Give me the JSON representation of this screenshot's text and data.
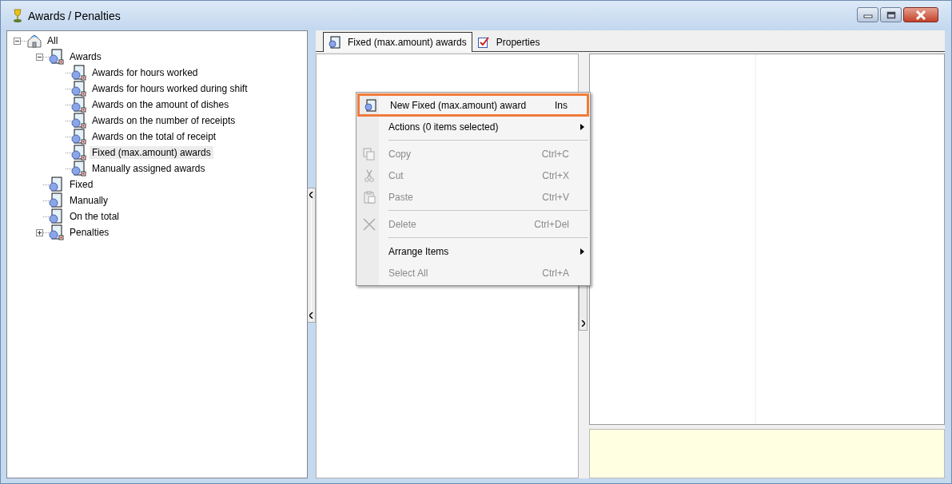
{
  "window": {
    "title": "Awards / Penalties"
  },
  "tree": [
    {
      "label": "All",
      "kind": "root",
      "expanded": true,
      "selected": false,
      "children": [
        {
          "label": "Awards",
          "kind": "group",
          "expanded": true,
          "selected": false,
          "children": [
            {
              "label": "Awards for hours worked",
              "kind": "group",
              "selected": false
            },
            {
              "label": "Awards for hours worked during shift",
              "kind": "group",
              "selected": false
            },
            {
              "label": "Awards on the amount of dishes",
              "kind": "group",
              "selected": false
            },
            {
              "label": "Awards on the number of receipts",
              "kind": "group",
              "selected": false
            },
            {
              "label": "Awards on the total of receipt",
              "kind": "group",
              "selected": false
            },
            {
              "label": "Fixed (max.amount) awards",
              "kind": "group",
              "selected": true
            },
            {
              "label": "Manually assigned awards",
              "kind": "group",
              "selected": false
            }
          ]
        },
        {
          "label": "Fixed",
          "kind": "rule",
          "selected": false
        },
        {
          "label": "Manually",
          "kind": "rule",
          "selected": false
        },
        {
          "label": "On the total",
          "kind": "rule",
          "selected": false
        },
        {
          "label": "Penalties",
          "kind": "group",
          "expanded": false,
          "selected": false
        }
      ]
    }
  ],
  "tabs": [
    {
      "label": "Fixed (max.amount) awards",
      "kind": "list",
      "selected": true
    },
    {
      "label": "Properties",
      "kind": "props",
      "selected": false
    }
  ],
  "context_menu": [
    {
      "kind": "new",
      "label": "New Fixed (max.amount) award",
      "shortcut": "Ins",
      "disabled": false,
      "submenu": false,
      "highlighted": true
    },
    {
      "kind": "plain",
      "label": "Actions (0 items selected)",
      "disabled": false,
      "submenu": true,
      "highlighted": false
    },
    {
      "kind": "separator"
    },
    {
      "kind": "copy",
      "label": "Copy",
      "shortcut": "Ctrl+C",
      "disabled": true,
      "submenu": false,
      "highlighted": false
    },
    {
      "kind": "cut",
      "label": "Cut",
      "shortcut": "Ctrl+X",
      "disabled": true,
      "submenu": false,
      "highlighted": false
    },
    {
      "kind": "paste",
      "label": "Paste",
      "shortcut": "Ctrl+V",
      "disabled": true,
      "submenu": false,
      "highlighted": false
    },
    {
      "kind": "separator"
    },
    {
      "kind": "delete",
      "label": "Delete",
      "shortcut": "Ctrl+Del",
      "disabled": true,
      "submenu": false,
      "highlighted": false
    },
    {
      "kind": "separator"
    },
    {
      "kind": "plain",
      "label": "Arrange Items",
      "disabled": false,
      "submenu": true,
      "highlighted": false
    },
    {
      "kind": "plain",
      "label": "Select All",
      "shortcut": "Ctrl+A",
      "disabled": true,
      "submenu": false,
      "highlighted": false
    }
  ]
}
